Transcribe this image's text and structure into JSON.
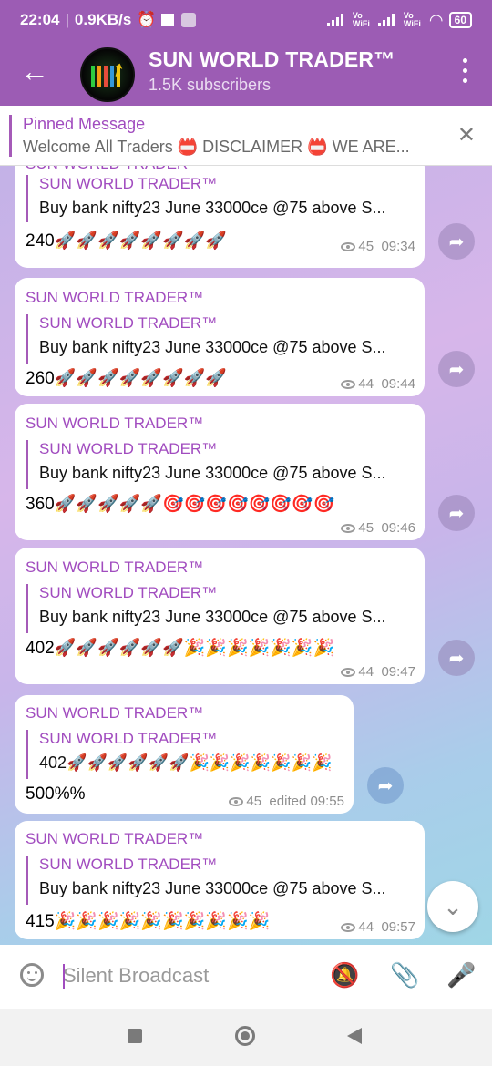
{
  "status_bar": {
    "time": "22:04",
    "speed": "0.9KB/s",
    "network1": "Vo WiFi",
    "network2": "Vo WiFi",
    "battery": "60"
  },
  "header": {
    "title": "SUN WORLD TRADER™",
    "subtitle": "1.5K subscribers"
  },
  "pinned": {
    "title": "Pinned Message",
    "text": "Welcome All Traders 📛 DISCLAIMER 📛 WE ARE..."
  },
  "messages": [
    {
      "author": "SUN WORLD TRADER™",
      "quote_author": "SUN WORLD TRADER™",
      "quote_text": "Buy bank nifty23 June  33000ce @75 above S...",
      "body": "240🚀🚀🚀🚀🚀🚀🚀🚀",
      "views": "45",
      "time": "09:34"
    },
    {
      "author": "SUN WORLD TRADER™",
      "quote_author": "SUN WORLD TRADER™",
      "quote_text": "Buy bank nifty23 June  33000ce @75 above S...",
      "body": "260🚀🚀🚀🚀🚀🚀🚀🚀",
      "views": "44",
      "time": "09:44"
    },
    {
      "author": "SUN WORLD TRADER™",
      "quote_author": "SUN WORLD TRADER™",
      "quote_text": "Buy bank nifty23 June  33000ce @75 above S...",
      "body": "360🚀🚀🚀🚀🚀🎯🎯🎯🎯🎯🎯🎯🎯",
      "views": "45",
      "time": "09:46"
    },
    {
      "author": "SUN WORLD TRADER™",
      "quote_author": "SUN WORLD TRADER™",
      "quote_text": "Buy bank nifty23 June  33000ce @75 above S...",
      "body": "402🚀🚀🚀🚀🚀🚀🎉🎉🎉🎉🎉🎉🎉",
      "views": "44",
      "time": "09:47"
    },
    {
      "author": "SUN WORLD TRADER™",
      "quote_author": "SUN WORLD TRADER™",
      "quote_text": "402🚀🚀🚀🚀🚀🚀🎉🎉🎉🎉🎉🎉🎉",
      "body": "500%%",
      "views": "45",
      "time": "edited 09:55"
    },
    {
      "author": "SUN WORLD TRADER™",
      "quote_author": "SUN WORLD TRADER™",
      "quote_text": "Buy bank nifty23 June  33000ce @75 above S...",
      "body": "415🎉🎉🎉🎉🎉🎉🎉🎉🎉🎉",
      "views": "44",
      "time": "09:57"
    }
  ],
  "input_bar": {
    "placeholder": "Silent Broadcast"
  },
  "icons": {
    "back": "arrow-left-icon",
    "menu": "more-vertical-icon",
    "close": "close-icon",
    "forward": "share-icon",
    "scroll": "chevron-down-icon",
    "emoji": "smile-icon",
    "mute": "bell-off-icon",
    "attach": "paperclip-icon",
    "mic": "microphone-icon"
  },
  "colors": {
    "header": "#9c5cb4",
    "accent": "#a14cbf"
  }
}
